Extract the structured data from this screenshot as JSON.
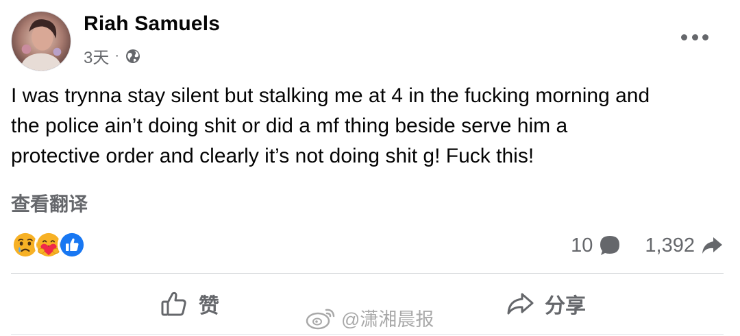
{
  "post": {
    "author": "Riah Samuels",
    "time": "3天",
    "separator": "·",
    "privacy_icon": "globe-icon",
    "more_icon": "more-options-icon",
    "text_lines": [
      "I was trynna stay silent but stalking me at 4 in the fucking morning and",
      "the police ain’t doing shit or did a mf thing beside serve him a",
      "protective order and clearly it’s not doing shit g! Fuck this!"
    ],
    "translate_label": "查看翻译",
    "reactions": [
      "sad-reaction-icon",
      "care-reaction-icon",
      "like-reaction-icon"
    ],
    "comments_count": "10",
    "shares_count": "1,392",
    "actions": {
      "like_label": "赞",
      "share_label": "分享"
    },
    "watermark": "@潇湘晨报"
  },
  "colors": {
    "text": "#050505",
    "secondary": "#65676b",
    "like_blue": "#1877f2",
    "reaction_yellow": "#f7b125",
    "care_red": "#f0284a",
    "divider": "#ced0d4"
  }
}
